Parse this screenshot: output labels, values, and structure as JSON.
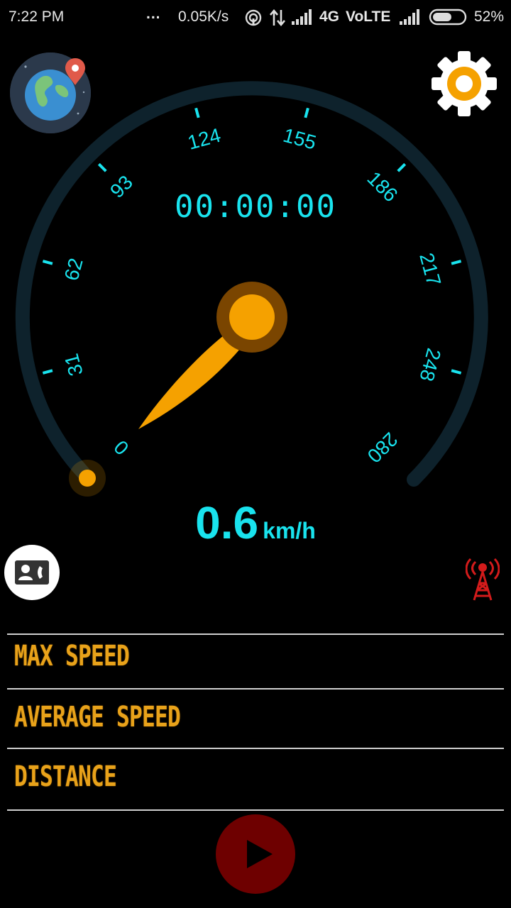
{
  "status_bar": {
    "time": "7:22 PM",
    "dots": "...",
    "net_speed": "0.05K/s",
    "network": "4G",
    "volte": "VoLTE",
    "battery": "52%",
    "icons": [
      "hotspot-icon",
      "data-arrows-icon",
      "signal-icon",
      "signal-icon",
      "battery-icon"
    ]
  },
  "header": {
    "globe_icon": "globe-map-icon",
    "settings_icon": "gear-icon"
  },
  "gauge": {
    "ticks": [
      "0",
      "31",
      "62",
      "93",
      "124",
      "155",
      "186",
      "217",
      "248",
      "280"
    ],
    "timer": "00:00:00",
    "speed_value": "0.6",
    "speed_unit": "km/h",
    "colors": {
      "accent": "#19e3ee",
      "needle": "#f5a100",
      "arc": "#0e222c"
    }
  },
  "actions": {
    "contact_icon": "contact-card-icon",
    "tower_icon": "signal-tower-icon"
  },
  "stats": {
    "max_speed": "MAX SPEED",
    "average_speed": "AVERAGE SPEED",
    "distance": "DISTANCE"
  },
  "controls": {
    "play_icon": "play-icon"
  }
}
